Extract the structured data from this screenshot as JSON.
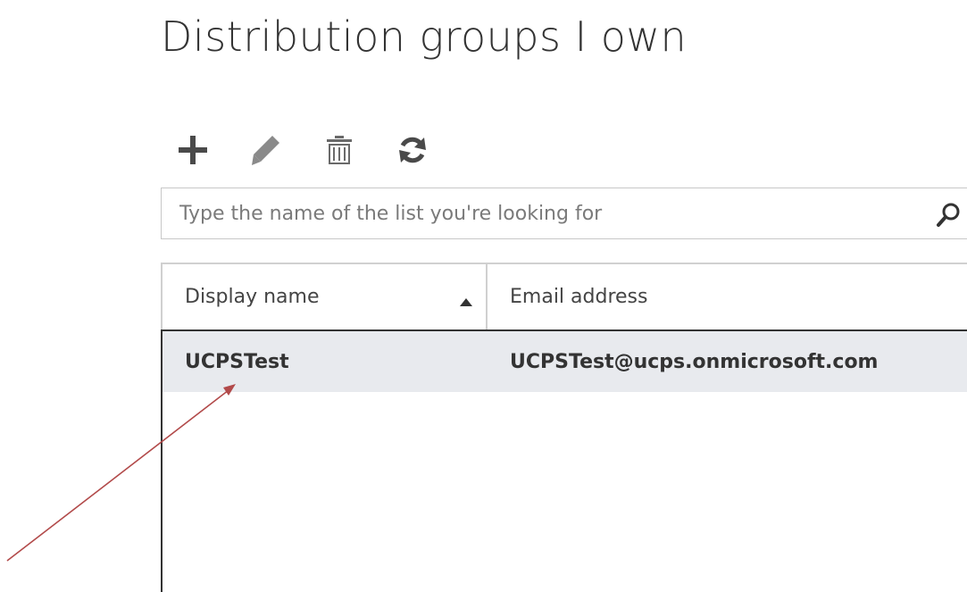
{
  "page": {
    "title": "Distribution groups I own"
  },
  "toolbar": {
    "buttons": [
      {
        "name": "add",
        "icon": "plus-icon"
      },
      {
        "name": "edit",
        "icon": "pencil-icon"
      },
      {
        "name": "delete",
        "icon": "trash-icon"
      },
      {
        "name": "refresh",
        "icon": "refresh-icon"
      }
    ]
  },
  "search": {
    "placeholder": "Type the name of the list you're looking for",
    "value": "",
    "icon": "search-icon"
  },
  "table": {
    "columns": [
      {
        "label": "Display name",
        "sort": "ascending"
      },
      {
        "label": "Email address"
      }
    ],
    "rows": [
      {
        "display_name": "UCPSTest",
        "email": "UCPSTest@ucps.onmicrosoft.com",
        "selected": true
      }
    ]
  },
  "colors": {
    "text": "#333333",
    "placeholder": "#7a7a7a",
    "icon": "#444444",
    "selected_row_bg": "#e8eaee",
    "annotation_arrow": "#b24a4a"
  }
}
